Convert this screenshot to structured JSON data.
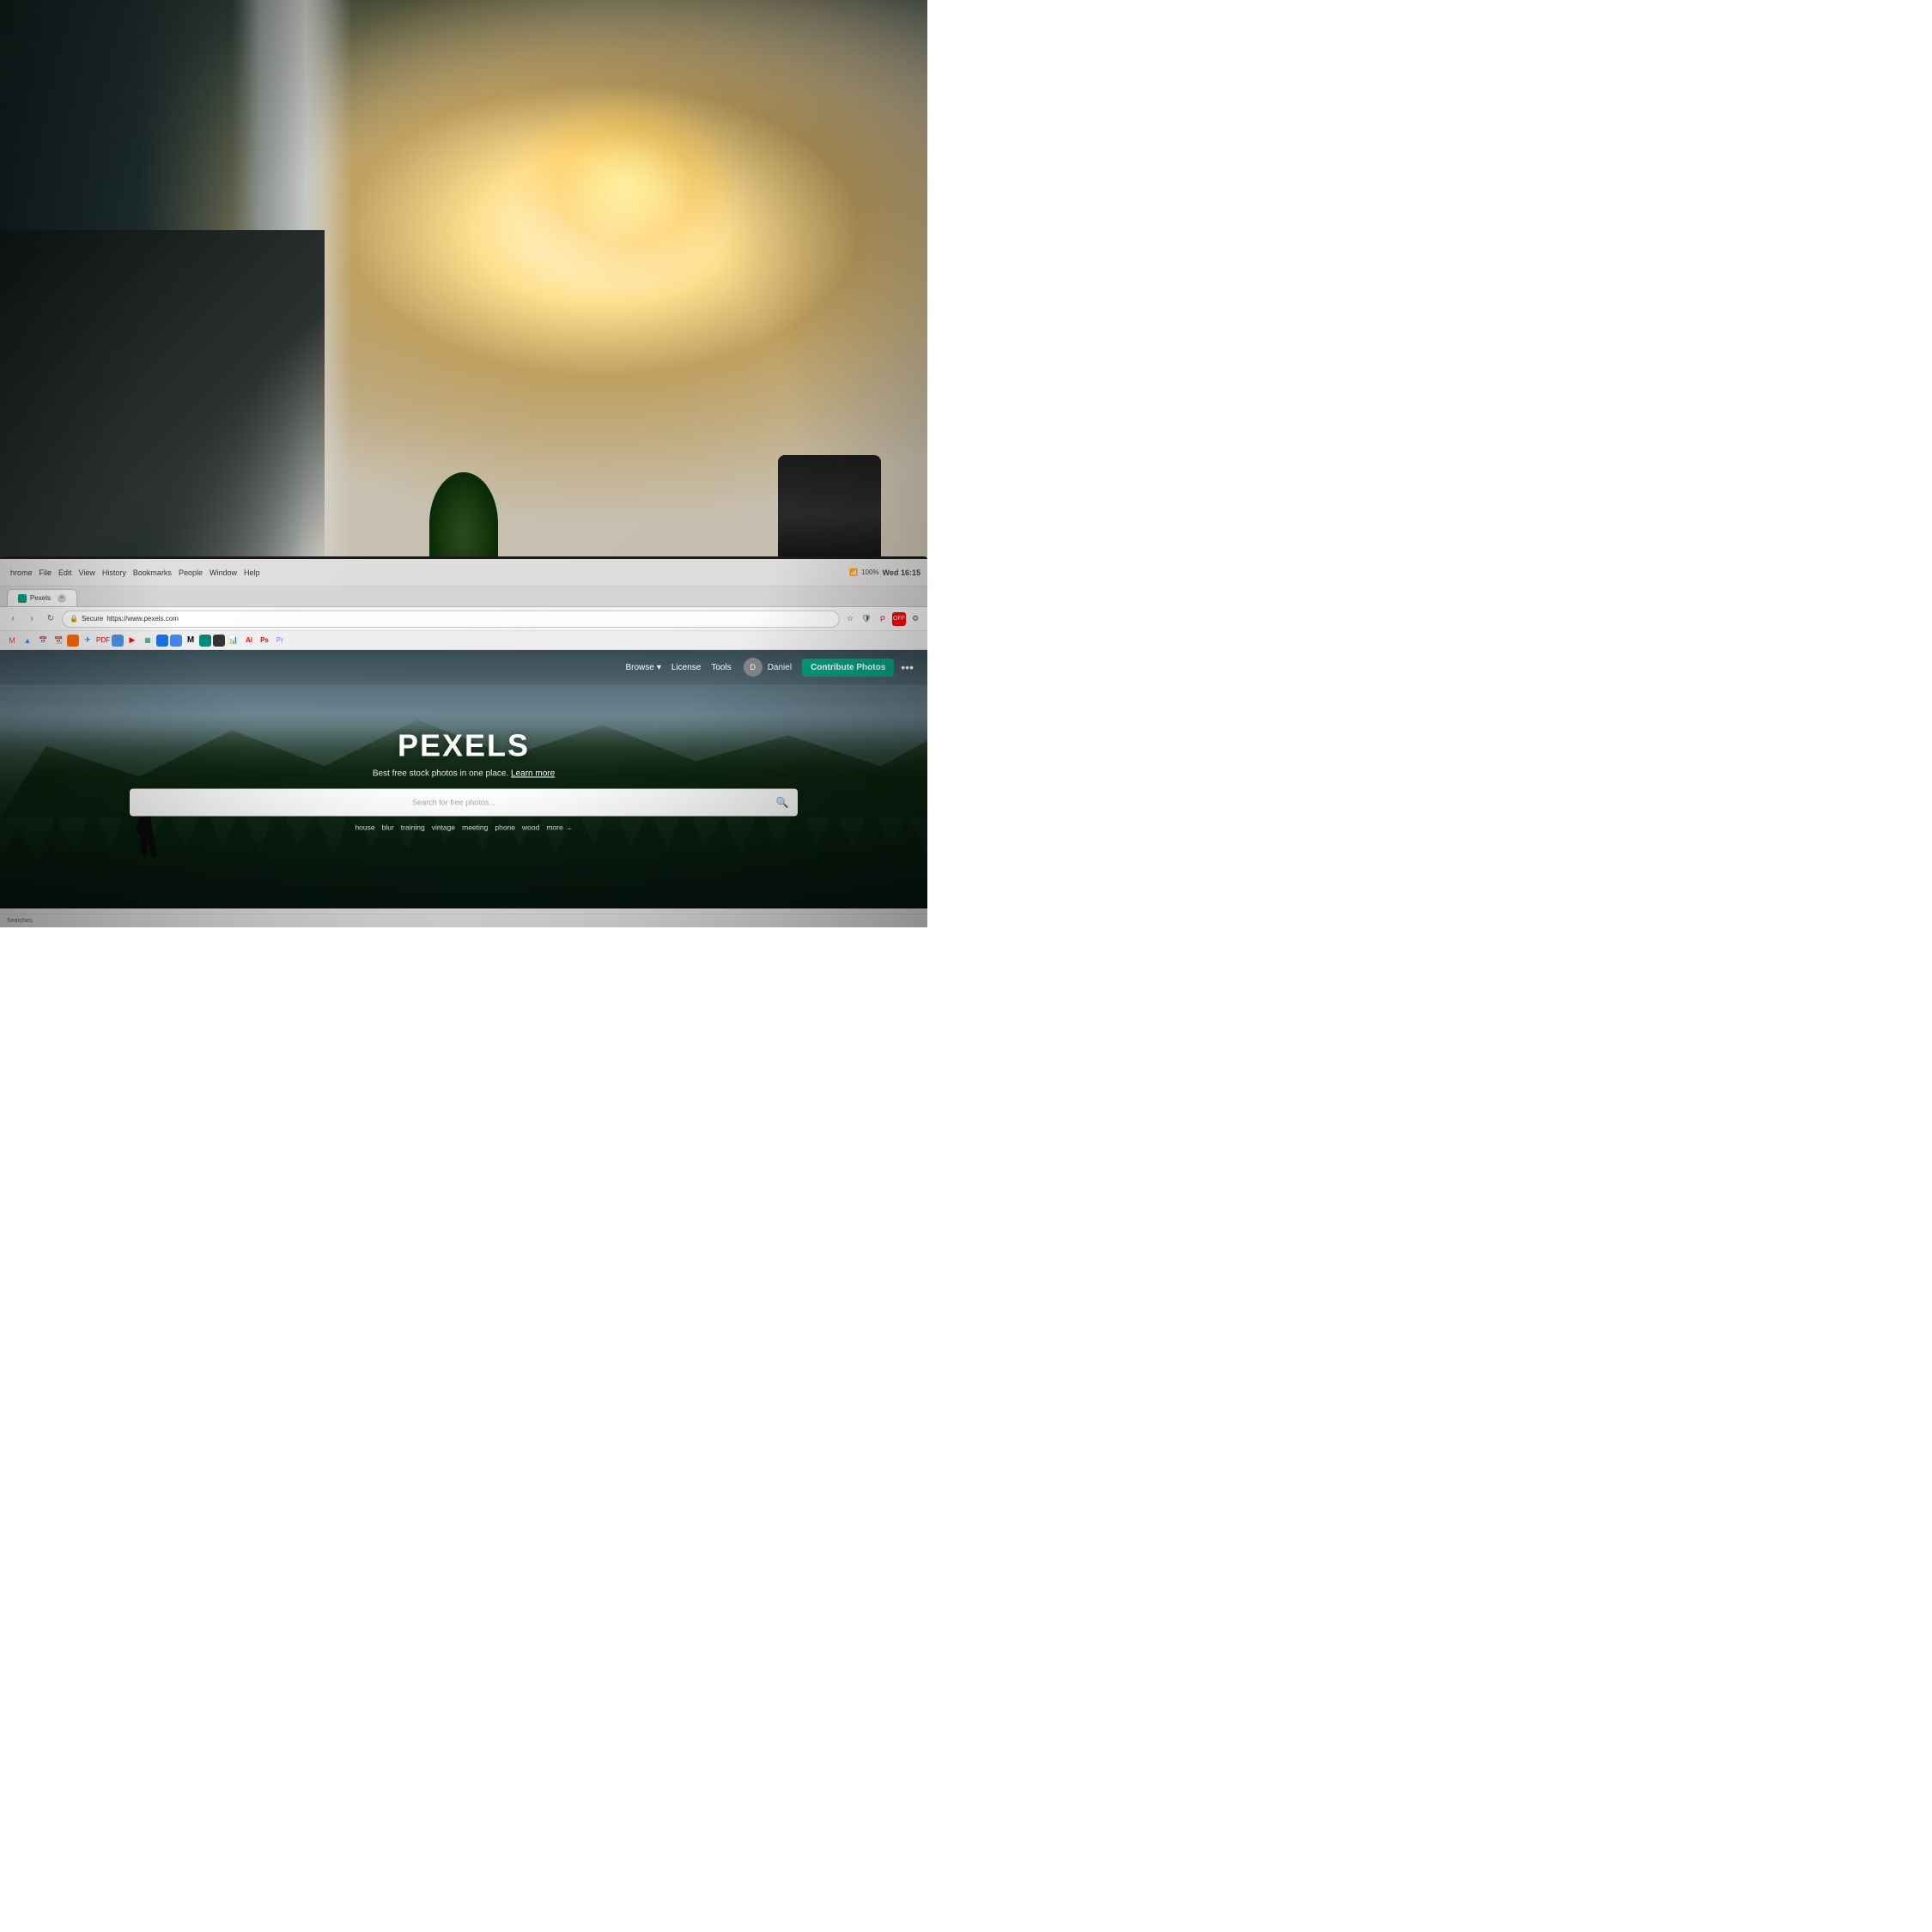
{
  "meta": {
    "dimensions": "1080x1080"
  },
  "office_bg": {
    "description": "Blurred office/workspace background photo with bright window light"
  },
  "browser": {
    "menu_items": [
      "hrome",
      "File",
      "Edit",
      "View",
      "History",
      "Bookmarks",
      "People",
      "Window",
      "Help"
    ],
    "system_info": {
      "time": "Wed 16:15",
      "battery": "100%"
    },
    "tab": {
      "favicon_color": "#05a081",
      "title": "Pexels"
    },
    "address_bar": {
      "secure_label": "Secure",
      "url": "https://www.pexels.com"
    },
    "nav_buttons": {
      "back": "‹",
      "forward": "›",
      "reload": "↻"
    }
  },
  "pexels": {
    "nav": {
      "browse_label": "Browse",
      "license_label": "License",
      "tools_label": "Tools",
      "username": "Daniel",
      "contribute_label": "Contribute Photos",
      "more_icon": "•••"
    },
    "hero": {
      "title": "PEXELS",
      "subtitle": "Best free stock photos in one place.",
      "subtitle_link": "Learn more",
      "search_placeholder": "Search for free photos...",
      "tags": [
        "house",
        "blur",
        "training",
        "vintage",
        "meeting",
        "phone",
        "wood",
        "more →"
      ]
    }
  },
  "status_bar": {
    "text": "Searches"
  }
}
